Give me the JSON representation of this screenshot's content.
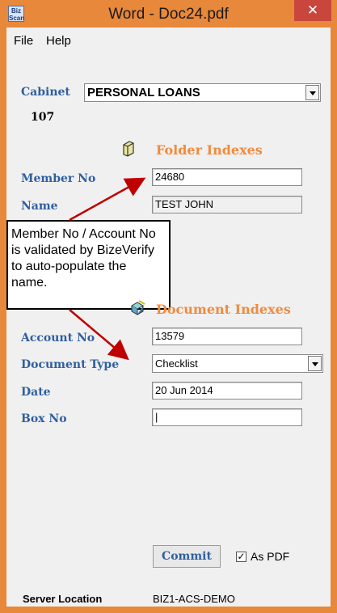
{
  "window": {
    "app_icon_text": "Biz Scan",
    "title": "Word - Doc24.pdf",
    "close_glyph": "✕"
  },
  "menu": {
    "items": [
      "File",
      "Help"
    ]
  },
  "cabinet": {
    "label": "Cabinet",
    "value": "PERSONAL LOANS",
    "count": "107"
  },
  "folder_indexes": {
    "header": "Folder Indexes",
    "icon": "folder-icon",
    "fields": [
      {
        "label": "Member No",
        "value": "24680"
      },
      {
        "label": "Name",
        "value": "TEST JOHN"
      }
    ]
  },
  "callout": {
    "text": "Member No / Account No is validated by BizeVerify to  auto-populate the name."
  },
  "document_indexes": {
    "header": "Document Indexes",
    "icon": "documents-icon",
    "fields": [
      {
        "label": "Account No",
        "value": "13579"
      },
      {
        "label": "Document Type",
        "value": "Checklist"
      },
      {
        "label": "Date",
        "value": "20 Jun 2014"
      },
      {
        "label": "Box No",
        "value": "|"
      }
    ]
  },
  "actions": {
    "commit_label": "Commit",
    "as_pdf_label": "As PDF",
    "as_pdf_checked": "✓"
  },
  "server": {
    "label": "Server Location",
    "value": "BIZ1-ACS-DEMO"
  },
  "colors": {
    "title_bar": "#e8883a",
    "close": "#c9463d",
    "label_blue": "#2f5fa0",
    "header_orange": "#f28a3c",
    "arrow_red": "#c00000"
  }
}
